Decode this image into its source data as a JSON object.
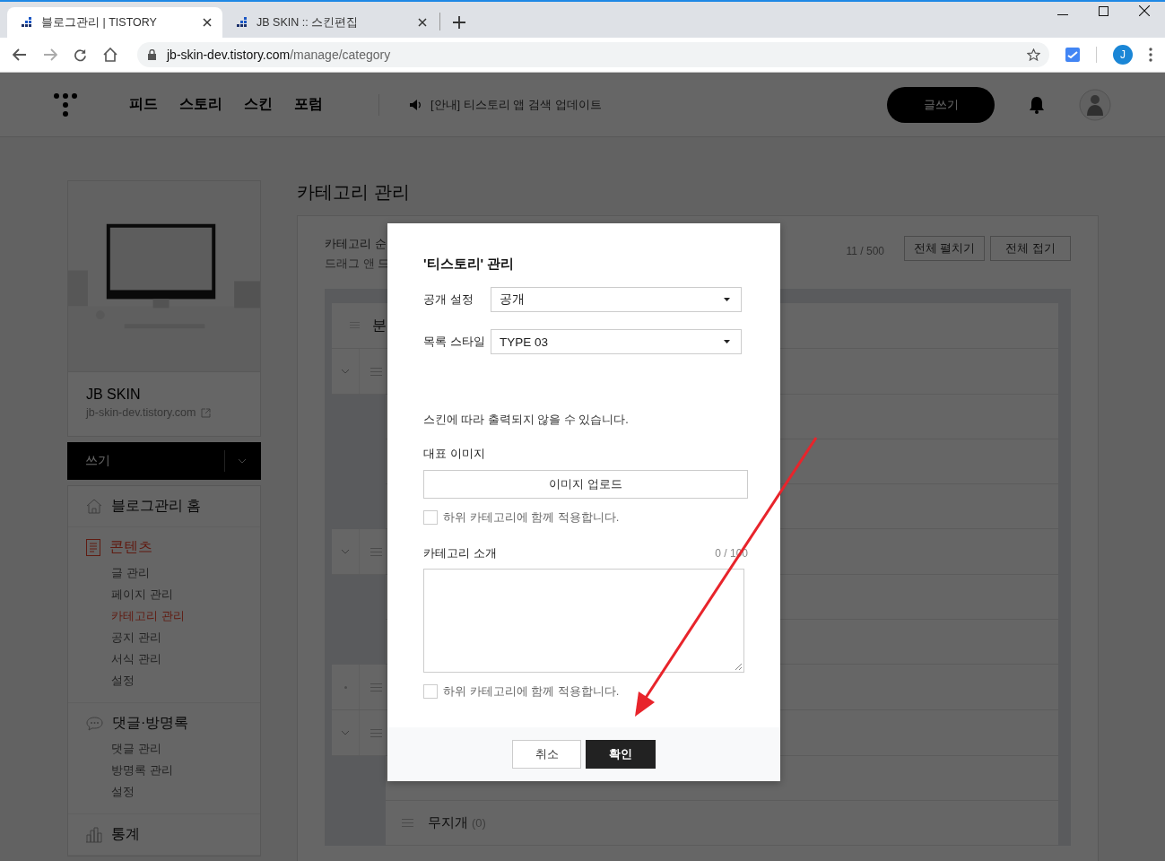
{
  "browser": {
    "tabs": [
      {
        "title": "블로그관리 | TISTORY",
        "selected": true
      },
      {
        "title": "JB SKIN :: 스킨편집",
        "selected": false
      }
    ],
    "url": {
      "host": "jb-skin-dev.tistory.com",
      "path": "/manage/category"
    },
    "profile": "J"
  },
  "header": {
    "nav": [
      "피드",
      "스토리",
      "스킨",
      "포럼"
    ],
    "notice": "[안내] 티스토리 앱 검색 업데이트",
    "write_button": "글쓰기"
  },
  "sidebar": {
    "blog_name": "JB SKIN",
    "blog_url": "jb-skin-dev.tistory.com",
    "write": "쓰기",
    "groups": [
      {
        "kind": "home",
        "title": "블로그관리 홈",
        "selected": false
      },
      {
        "kind": "document",
        "title": "콘텐츠",
        "selected": true,
        "items": [
          {
            "label": "글 관리",
            "selected": false
          },
          {
            "label": "페이지 관리",
            "selected": false
          },
          {
            "label": "카테고리 관리",
            "selected": true
          },
          {
            "label": "공지 관리",
            "selected": false
          },
          {
            "label": "서식 관리",
            "selected": false
          },
          {
            "label": "설정",
            "selected": false
          }
        ]
      },
      {
        "kind": "comment",
        "title": "댓글·방명록",
        "selected": false,
        "items": [
          {
            "label": "댓글 관리",
            "selected": false
          },
          {
            "label": "방명록 관리",
            "selected": false
          },
          {
            "label": "설정",
            "selected": false
          }
        ]
      },
      {
        "kind": "chart",
        "title": "통계",
        "selected": false
      }
    ]
  },
  "main": {
    "title": "카테고리 관리",
    "info_lines": [
      "카테고리 순",
      "드래그 앤 드"
    ],
    "count": "11",
    "limit": "/ 500",
    "buttons": [
      "전체 펼치기",
      "전체 접기"
    ],
    "rows": [
      {
        "kind": "root",
        "text": "분"
      },
      {
        "kind": "parent"
      },
      {
        "kind": "child"
      },
      {
        "kind": "child"
      },
      {
        "kind": "child"
      },
      {
        "kind": "parent"
      },
      {
        "kind": "child"
      },
      {
        "kind": "child"
      },
      {
        "kind": "leaf"
      },
      {
        "kind": "parent"
      },
      {
        "kind": "child"
      },
      {
        "kind": "child",
        "text": "무지개",
        "count": "(0)"
      }
    ]
  },
  "modal": {
    "title": "'티스토리' 관리",
    "fields": [
      {
        "label": "공개 설정",
        "value": "공개"
      },
      {
        "label": "목록 스타일",
        "value": "TYPE 03"
      }
    ],
    "note": "스킨에 따라 출력되지 않을 수 있습니다.",
    "image_label": "대표 이미지",
    "upload": "이미지 업로드",
    "apply_image": {
      "label": "하위 카테고리에 함께 적용합니다.",
      "checked": false
    },
    "intro_label": "카테고리 소개",
    "intro_counter": "0 / 100",
    "apply_intro": {
      "label": "하위 카테고리에 함께 적용합니다.",
      "checked": false
    },
    "cancel": "취소",
    "ok": "확인"
  }
}
